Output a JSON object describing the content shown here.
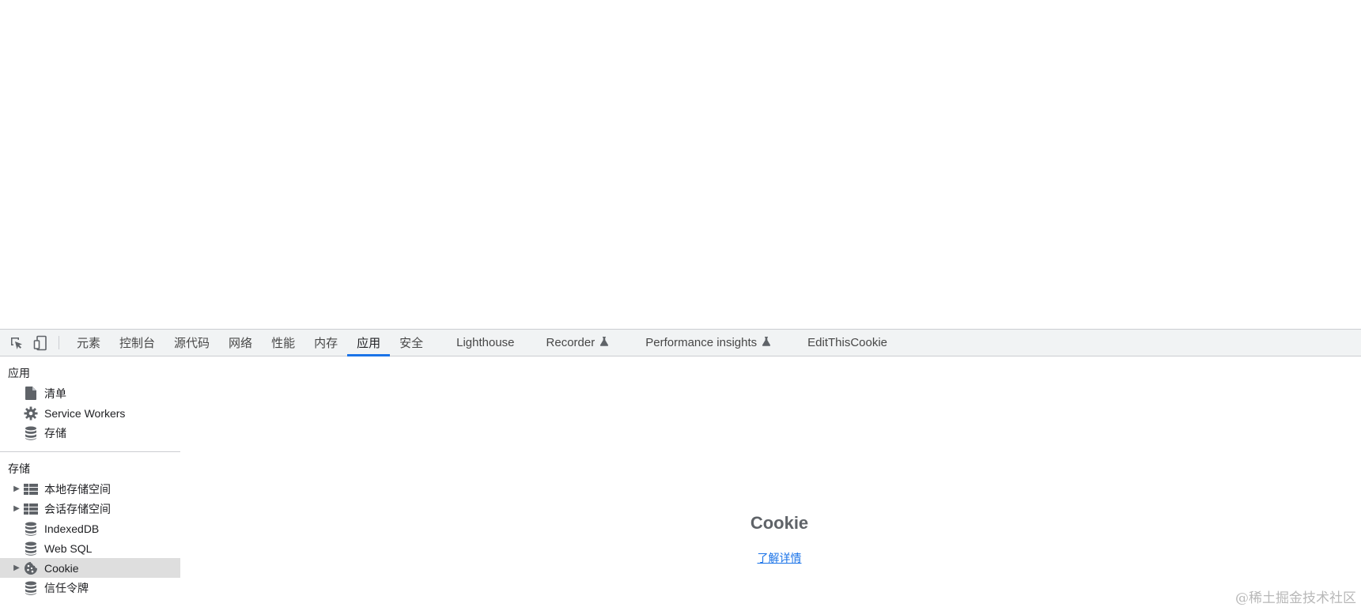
{
  "devtools": {
    "toolbar": {
      "tabs": [
        {
          "label": "元素"
        },
        {
          "label": "控制台"
        },
        {
          "label": "源代码"
        },
        {
          "label": "网络"
        },
        {
          "label": "性能"
        },
        {
          "label": "内存"
        },
        {
          "label": "应用"
        },
        {
          "label": "安全"
        },
        {
          "label": "Lighthouse"
        },
        {
          "label": "Recorder"
        },
        {
          "label": "Performance insights"
        },
        {
          "label": "EditThisCookie"
        }
      ],
      "active_tab": "应用"
    },
    "sidebar": {
      "app_section": {
        "title": "应用",
        "items": [
          {
            "label": "清单",
            "icon": "document-icon"
          },
          {
            "label": "Service Workers",
            "icon": "gear-icon"
          },
          {
            "label": "存储",
            "icon": "database-icon"
          }
        ]
      },
      "storage_section": {
        "title": "存储",
        "items": [
          {
            "label": "本地存储空间",
            "icon": "table-icon",
            "expandable": true
          },
          {
            "label": "会话存储空间",
            "icon": "table-icon",
            "expandable": true
          },
          {
            "label": "IndexedDB",
            "icon": "database-icon",
            "expandable": false
          },
          {
            "label": "Web SQL",
            "icon": "database-icon",
            "expandable": false
          },
          {
            "label": "Cookie",
            "icon": "cookie-icon",
            "expandable": true,
            "selected": true
          },
          {
            "label": "信任令牌",
            "icon": "database-icon",
            "expandable": false
          }
        ]
      }
    },
    "main": {
      "title": "Cookie",
      "link_label": "了解详情"
    },
    "watermark": "@稀土掘金技术社区",
    "colors": {
      "accent": "#1a73e8",
      "toolbar_bg": "#f1f3f4",
      "selected_bg": "#dedede"
    }
  }
}
